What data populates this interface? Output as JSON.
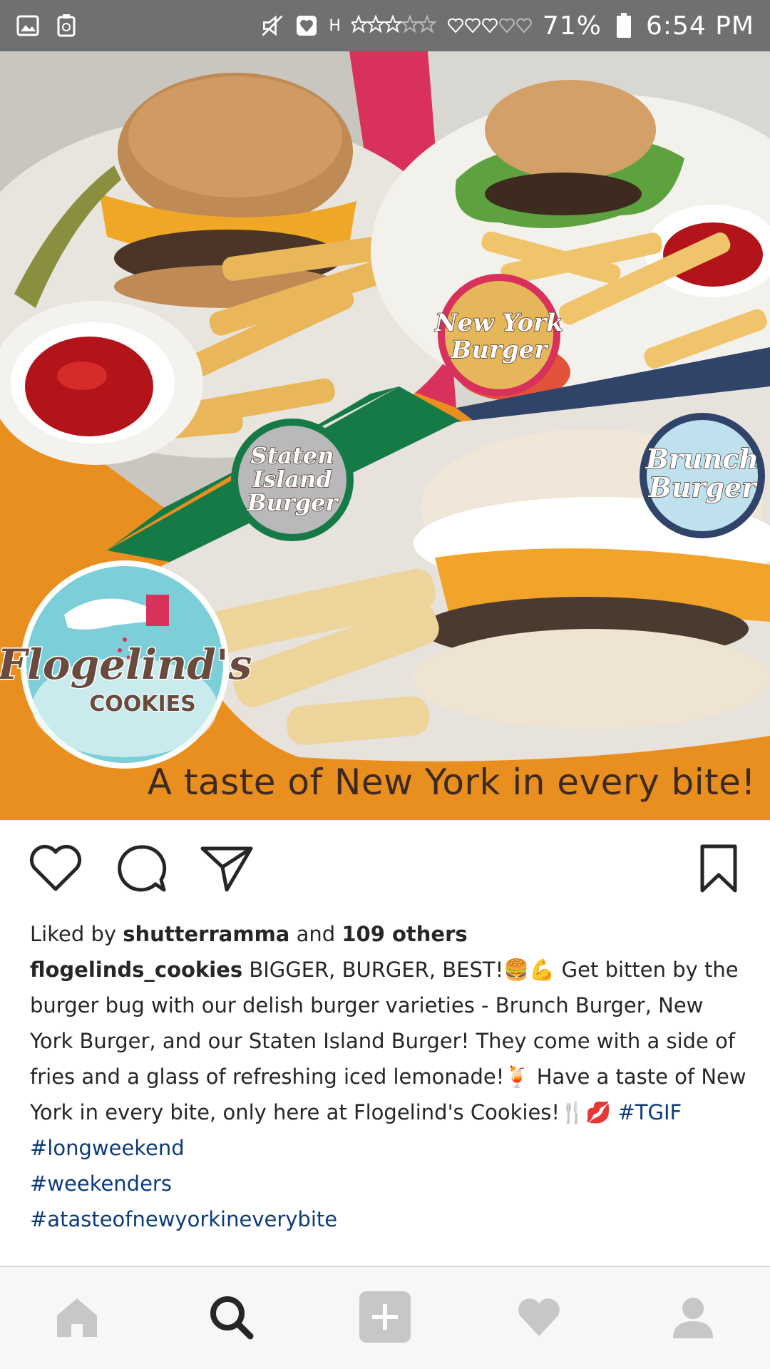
{
  "status_bar": {
    "battery_percent": "71%",
    "time": "6:54 PM",
    "network_label": "H",
    "icons": [
      "gallery-icon",
      "recycle-icon",
      "mute-icon",
      "heart-notification-icon",
      "signal-icon",
      "battery-icon"
    ]
  },
  "post": {
    "image_alt": "Flogelind's Cookies burger promo",
    "badges": {
      "new_york": [
        "New York",
        "Burger"
      ],
      "staten_island": [
        "Staten",
        "Island",
        "Burger"
      ],
      "brunch": [
        "Brunch",
        "Burger"
      ]
    },
    "logo": {
      "brand": "Flogelind's",
      "sub": "COOKIES"
    },
    "tagline": "A taste of New York in every bite!",
    "colors": {
      "orange": "#e98f1f",
      "pink": "#d8315c",
      "green": "#157a46",
      "navy": "#2f4468",
      "logo_teal": "#7ccfd8"
    }
  },
  "actions": {
    "like": "heart-outline-icon",
    "comment": "comment-icon",
    "share": "send-icon",
    "save": "bookmark-icon"
  },
  "likes": {
    "prefix": "Liked by",
    "user": "shutterramma",
    "middle": "and",
    "others": "109 others"
  },
  "caption": {
    "username": "flogelinds_cookies",
    "text": "BIGGER, BURGER, BEST!🍔💪 Get bitten by the burger bug with our delish burger varieties - Brunch Burger, New York Burger, and our Staten Island Burger! They come with a side of fries and a glass of refreshing iced lemonade!🍹 Have a taste of New York in every bite, only here at Flogelind's Cookies!🍴💋",
    "inline_hashtag": "#TGIF",
    "hashtags": [
      "#longweekend",
      "#weekenders",
      "#atasteofnewyorkineverybite"
    ]
  },
  "bottom_nav": {
    "items": [
      "home-icon",
      "search-icon",
      "add-post-icon",
      "activity-heart-icon",
      "profile-icon"
    ]
  }
}
